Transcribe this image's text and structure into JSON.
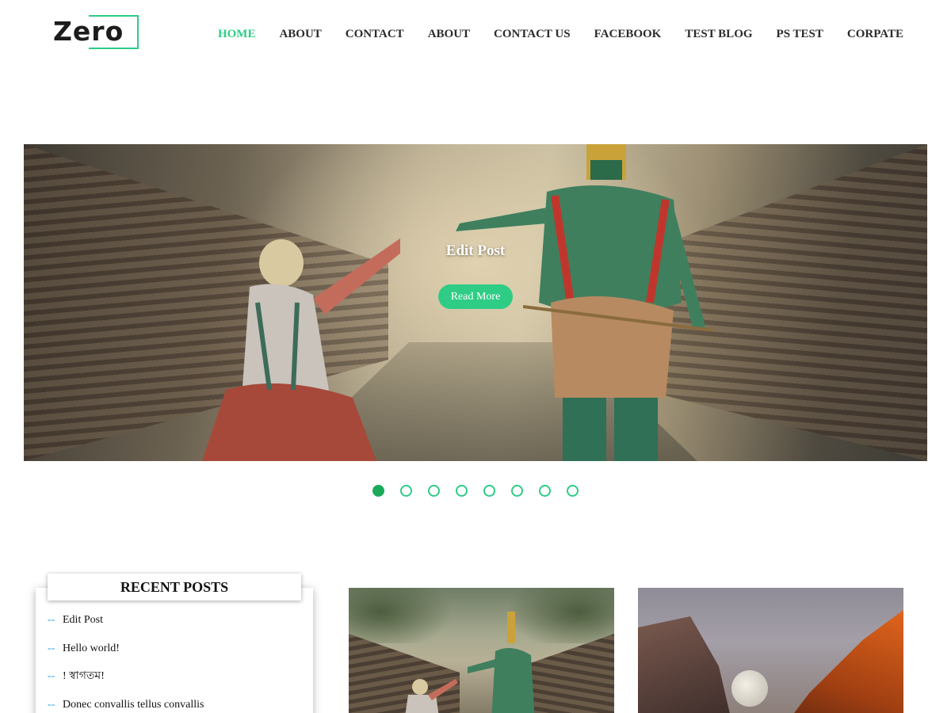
{
  "logo": {
    "text": "Zero"
  },
  "nav": {
    "items": [
      {
        "label": "HOME",
        "active": true
      },
      {
        "label": "ABOUT",
        "active": false
      },
      {
        "label": "CONTACT",
        "active": false
      },
      {
        "label": "ABOUT",
        "active": false
      },
      {
        "label": "CONTACT US",
        "active": false
      },
      {
        "label": "FACEBOOK",
        "active": false
      },
      {
        "label": "TEST BLOG",
        "active": false
      },
      {
        "label": "PS TEST",
        "active": false
      },
      {
        "label": "CORPATE",
        "active": false
      }
    ]
  },
  "slider": {
    "caption": "Edit Post",
    "button_label": "Read More",
    "slide_count": 8,
    "active_slide": 1
  },
  "recent_posts": {
    "title": "RECENT POSTS",
    "bullet": "--",
    "items": [
      {
        "label": "Edit Post"
      },
      {
        "label": "Hello world!"
      },
      {
        "label": "! স্বাগতম!"
      },
      {
        "label": "Donec convallis tellus convallis"
      }
    ]
  },
  "colors": {
    "accent": "#2ecc85",
    "accent_dark": "#1aaa5a",
    "link_dash": "#2ea0e6"
  }
}
